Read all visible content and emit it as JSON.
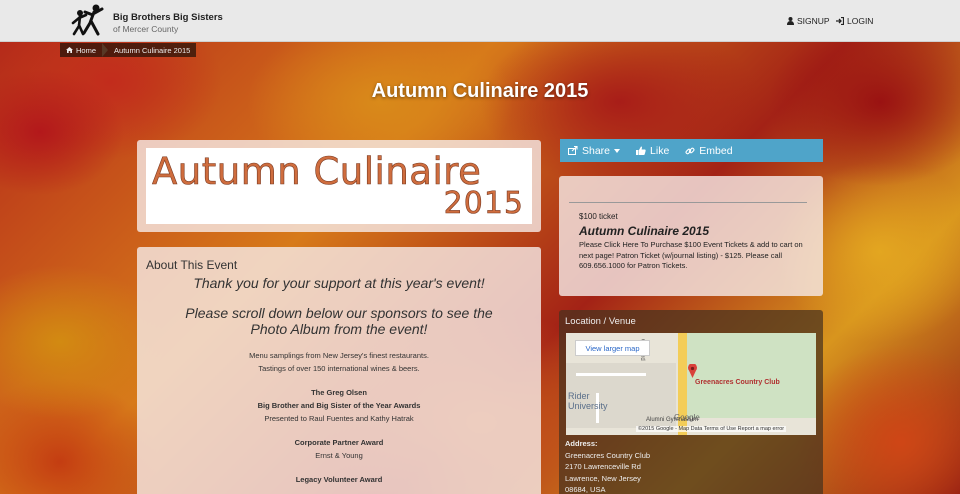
{
  "header": {
    "org_name": "Big Brothers Big Sisters",
    "org_sub": "of Mercer County",
    "signup": "SIGNUP",
    "login": "LOGIN"
  },
  "breadcrumb": {
    "home": "Home",
    "current": "Autumn Culinaire 2015"
  },
  "page_title": "Autumn Culinaire 2015",
  "banner": {
    "line1": "Autumn Culinaire",
    "line2": "2015"
  },
  "about": {
    "heading": "About This Event",
    "thanks": "Thank you for  your support at this year's event!",
    "scroll_note": "Please scroll down below our sponsors to see the Photo Album from the event!",
    "info_line1": "Menu samplings from New Jersey's finest restaurants.",
    "info_line2": "Tastings of over 150 international wines & beers.",
    "award1_title1": "The Greg Olsen",
    "award1_title2": "Big Brother and Big Sister of the Year Awards",
    "award1_presenters": "Presented to Raul Fuentes and Kathy Hatrak",
    "award2_title": "Corporate Partner Award",
    "award2_winner": "Ernst & Young",
    "award3_title": "Legacy Volunteer Award"
  },
  "share_bar": {
    "share": "Share",
    "like": "Like",
    "embed": "Embed"
  },
  "ticket": {
    "price": "$100 ticket",
    "name": "Autumn Culinaire 2015",
    "description": "Please Click Here To Purchase $100 Event Tickets & add to cart on next page! Patron Ticket (w/journal listing) - $125. Please call 609.656.1000 for Patron Tickets."
  },
  "venue": {
    "title": "Location / Venue",
    "map_button": "View larger map",
    "map_pin_label": "Greenacres Country Club",
    "map_rider": "Rider\nUniversity",
    "map_google": "Google",
    "map_orchard": "Orchard",
    "map_gym": "Alumni Gymnasium",
    "map_footer": "©2015 Google - Map Data    Terms of Use    Report a map error",
    "address_label": "Address:",
    "address_line1": "Greenacres Country Club",
    "address_line2": "2170 Lawrenceville Rd",
    "address_line3": "Lawrence, New Jersey",
    "address_line4": "08684, USA"
  },
  "colors": {
    "share_bar": "#4fa4c9",
    "banner_text": "#cf6d3e",
    "map_pin": "#d9413a"
  }
}
